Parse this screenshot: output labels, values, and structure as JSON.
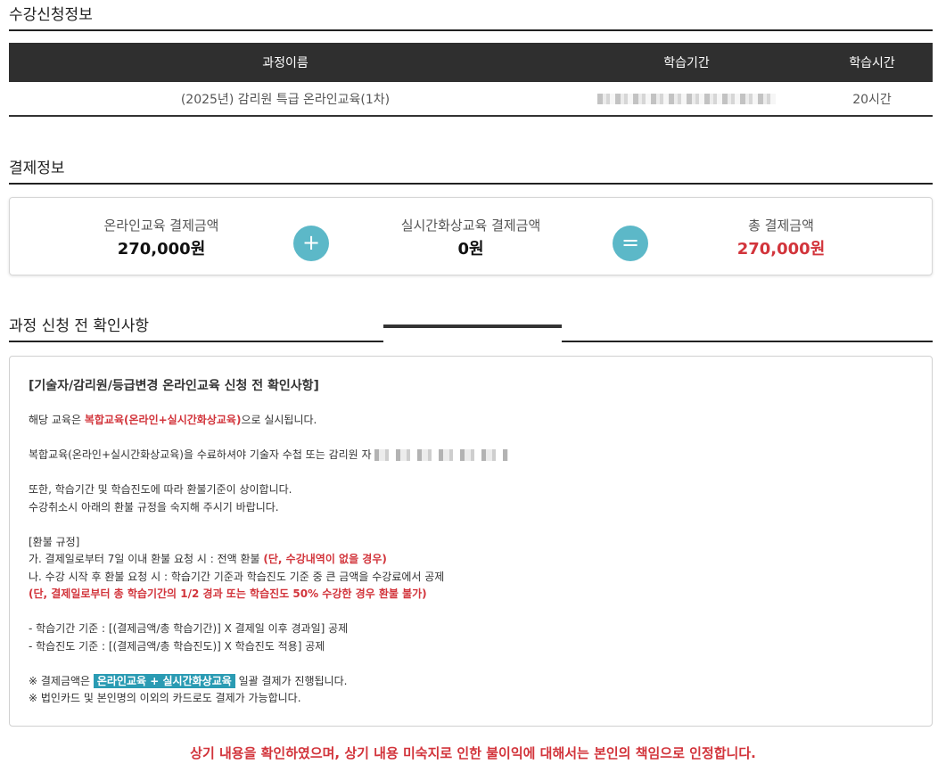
{
  "sections": {
    "course_title": "수강신청정보",
    "payment_title": "결제정보",
    "notice_title": "과정 신청 전 확인사항"
  },
  "course_table": {
    "headers": {
      "name": "과정이름",
      "period": "학습기간",
      "hours": "학습시간"
    },
    "rows": [
      {
        "name": "(2025년) 감리원 특급 온라인교육(1차)",
        "hours": "20시간"
      }
    ]
  },
  "payment": {
    "online_label": "온라인교육 결제금액",
    "online_value": "270,000원",
    "live_label": "실시간화상교육 결제금액",
    "live_value": "0원",
    "total_label": "총 결제금액",
    "total_value": "270,000원",
    "plus": "+",
    "equals": "="
  },
  "notice": {
    "heading": "[기술자/감리원/등급변경 온라인교육 신청 전 확인사항]",
    "l1_pre": "해당 교육은 ",
    "l1_hl": "복합교육(온라인+실시간화상교육)",
    "l1_post": "으로 실시됩니다.",
    "l2": "복합교육(온라인+실시간화상교육)을 수료하셔야 기술자 수첩 또는 감리원 자",
    "l3": "또한, 학습기간 및 학습진도에 따라 환불기준이 상이합니다.",
    "l4": "수강취소시 아래의 환불 규정을 숙지해 주시기 바랍니다.",
    "l5": "[환불 규정]",
    "l6_pre": "가. 결제일로부터 7일 이내 환불 요청 시 : 전액 환불 ",
    "l6_hl": "(단, 수강내역이 없을 경우)",
    "l7": "나. 수강 시작 후 환불 요청 시 : 학습기간 기준과 학습진도 기준 중 큰 금액을 수강료에서 공제",
    "l8": "(단, 결제일로부터 총 학습기간의 1/2 경과 또는 학습진도 50% 수강한 경우 환불 불가)",
    "l9": "- 학습기간 기준 : [(결제금액/총 학습기간)] X 결제일 이후 경과일] 공제",
    "l10": "- 학습진도 기준 : [(결제금액/총 학습진도)] X 학습진도 적용] 공제",
    "l11_pre": "※ 결제금액은 ",
    "l11_hl": "온라인교육 + 실시간화상교육",
    "l11_post": " 일괄 결제가 진행됩니다.",
    "l12": "※ 법인카드 및 본인명의 이외의 카드로도 결제가 가능합니다."
  },
  "final_note": "상기 내용을 확인하였으며, 상기 내용 미숙지로 인한 불이익에 대해서는 본인의 책임으로 인정합니다."
}
